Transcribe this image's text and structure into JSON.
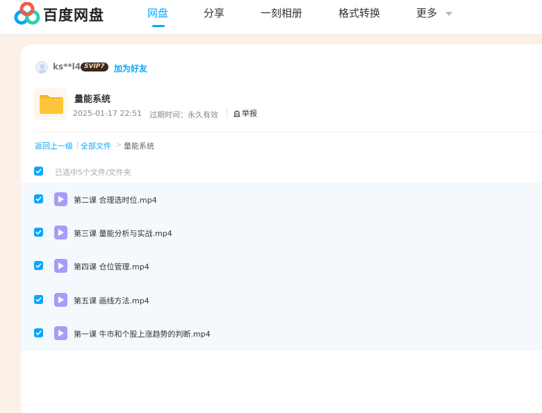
{
  "header": {
    "brand": "百度网盘",
    "nav": [
      "网盘",
      "分享",
      "一刻相册",
      "格式转换",
      "更多"
    ],
    "active_color": "#06a7ff"
  },
  "share": {
    "username": "ks**l4",
    "vip_badge": "SVIP7",
    "add_friend": "加为好友",
    "folder_title": "量能系统",
    "date": "2025-01-17 22:51",
    "expiry": "过期时间：永久有效",
    "report": "举报"
  },
  "breadcrumb": {
    "back": "返回上一级",
    "separator": "|",
    "all_files": "全部文件",
    "arrow": ">",
    "current": "量能系统"
  },
  "selection": {
    "info": "已选中5个文件/文件夹"
  },
  "files": [
    {
      "name": "第二课 合理选时位.mp4"
    },
    {
      "name": "第三课 量能分析与实战.mp4"
    },
    {
      "name": "第四课 仓位管理.mp4"
    },
    {
      "name": "第五课 画线方法.mp4"
    },
    {
      "name": "第一课 牛市和个股上涨趋势的判断.mp4"
    }
  ]
}
